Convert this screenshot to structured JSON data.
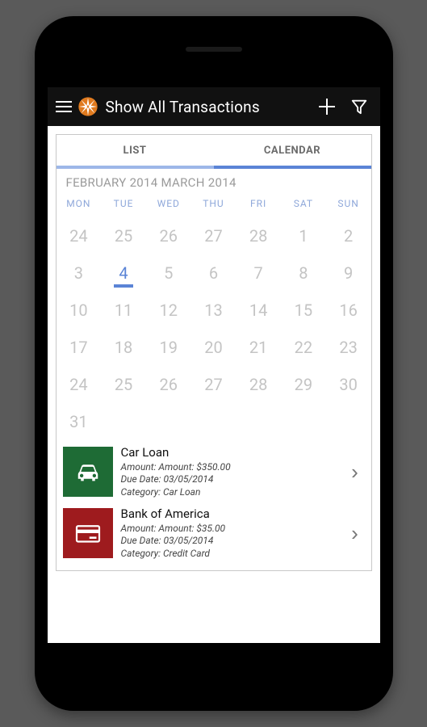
{
  "header": {
    "title": "Show All Transactions"
  },
  "tabs": {
    "list_label": "LIST",
    "calendar_label": "CALENDAR"
  },
  "calendar": {
    "months_label": "FEBRUARY 2014 MARCH 2014",
    "day_headers": [
      "MON",
      "TUE",
      "WED",
      "THU",
      "FRI",
      "SAT",
      "SUN"
    ],
    "weeks": [
      [
        "24",
        "25",
        "26",
        "27",
        "28",
        "1",
        "2"
      ],
      [
        "3",
        "4",
        "5",
        "6",
        "7",
        "8",
        "9"
      ],
      [
        "10",
        "11",
        "12",
        "13",
        "14",
        "15",
        "16"
      ],
      [
        "17",
        "18",
        "19",
        "20",
        "21",
        "22",
        "23"
      ],
      [
        "24",
        "25",
        "26",
        "27",
        "28",
        "29",
        "30"
      ],
      [
        "31",
        "",
        "",
        "",
        "",
        "",
        ""
      ]
    ],
    "selected_label": "4"
  },
  "labels": {
    "amount": "Amount:",
    "due_date": "Due Date:",
    "category": "Category:"
  },
  "transactions": [
    {
      "title": "Car Loan",
      "amount": "Amount: $350.00",
      "due_date": "03/05/2014",
      "category": "Car Loan",
      "color": "green",
      "icon": "car-icon"
    },
    {
      "title": "Bank of America",
      "amount": "Amount: $35.00",
      "due_date": "03/05/2014",
      "category": "Credit Card",
      "color": "red",
      "icon": "credit-card-icon"
    }
  ]
}
